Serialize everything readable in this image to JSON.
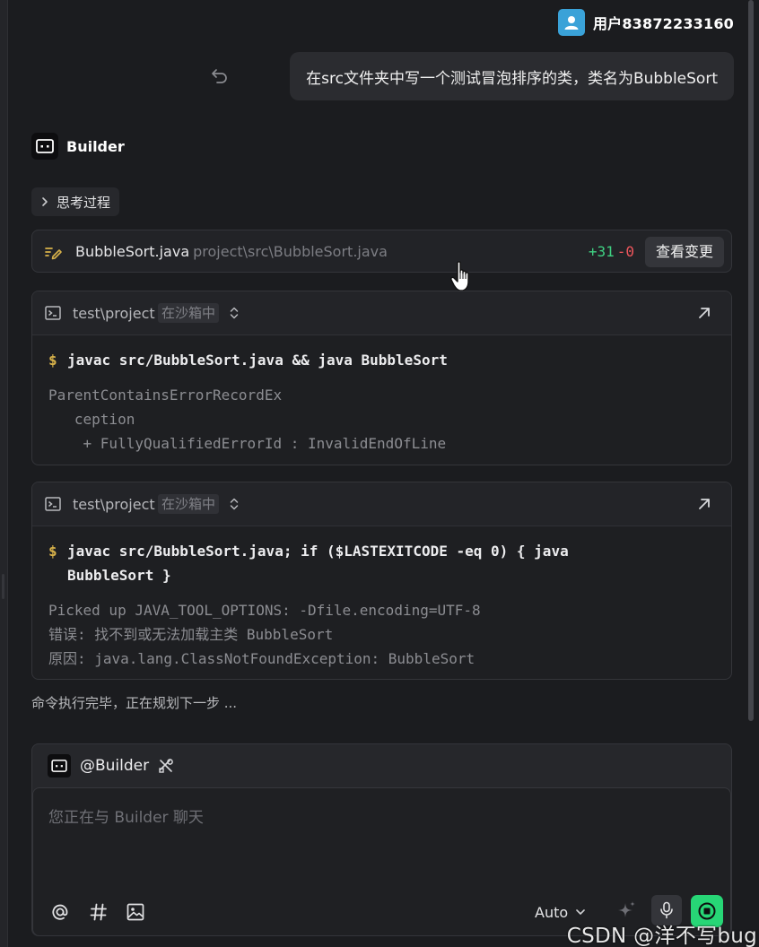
{
  "user": {
    "name": "用户83872233160",
    "avatar_color": "#3aa2d8",
    "message": "在src文件夹中写一个测试冒泡排序的类，类名为BubbleSort"
  },
  "assistant": {
    "name": "Builder",
    "thinking_label": "思考过程"
  },
  "file_change": {
    "file_name": "BubbleSort.java",
    "file_path": "project\\src\\BubbleSort.java",
    "added": "+31",
    "removed": "-0",
    "view_label": "查看变更",
    "added_color": "#3fd182",
    "removed_color": "#f0565c"
  },
  "terminals": [
    {
      "path": "test\\project",
      "badge": "在沙箱中",
      "prompt": "$",
      "command": "javac src/BubbleSort.java && java BubbleSort",
      "output": [
        "ParentContainsErrorRecordEx",
        "   ception",
        "    + FullyQualifiedErrorId : InvalidEndOfLine"
      ]
    },
    {
      "path": "test\\project",
      "badge": "在沙箱中",
      "prompt": "$",
      "command": "javac src/BubbleSort.java; if ($LASTEXITCODE -eq 0) { java\nBubbleSort }",
      "output": [
        "Picked up JAVA_TOOL_OPTIONS: -Dfile.encoding=UTF-8",
        "错误: 找不到或无法加载主类 BubbleSort",
        "原因: java.lang.ClassNotFoundException: BubbleSort"
      ]
    }
  ],
  "status_text": "命令执行完毕，正在规划下一步 ...",
  "composer": {
    "mention": "@Builder",
    "placeholder": "您正在与 Builder 聊天",
    "model": "Auto",
    "accent_color": "#27d676"
  },
  "watermark": "CSDN @洋不写bug"
}
